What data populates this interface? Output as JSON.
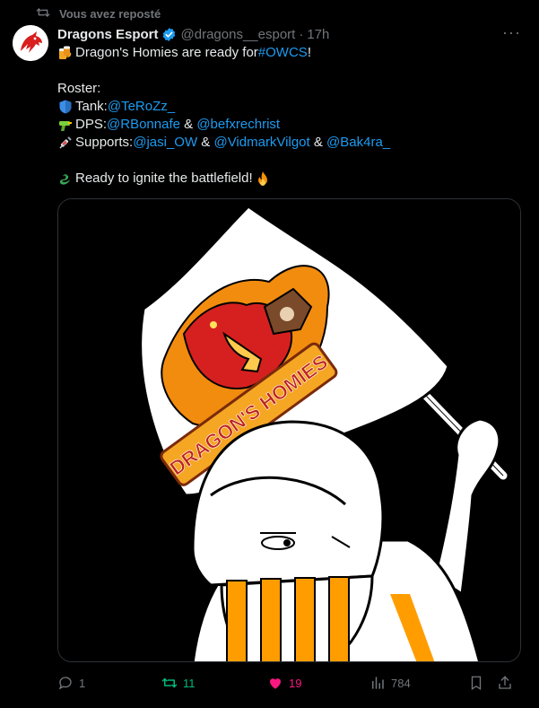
{
  "repost_notice": "Vous avez reposté",
  "tweet": {
    "author_name": "Dragons Esport",
    "handle": "@dragons__esport",
    "separator": "·",
    "time": "17h",
    "line1_text": "Dragon's Homies are ready for ",
    "line1_hashtag": "#OWCS",
    "line1_end": "!",
    "roster_label": "Roster:",
    "tank_label": "Tank: ",
    "tank_player": "@TeRoZz_",
    "dps_label": "DPS: ",
    "dps_player1": "@RBonnafe",
    "amp": " & ",
    "dps_player2": "@befxrechrist",
    "supports_label": "Supports: ",
    "support_player1": "@jasi_OW",
    "support_player2": "@VidmarkVilgot",
    "support_player3": "@Bak4ra_",
    "closing": "Ready to ignite the battlefield!",
    "image_flag_text": "DRAGON'S HOMIES"
  },
  "actions": {
    "replies": "1",
    "reposts": "11",
    "likes": "19",
    "views": "784"
  },
  "colors": {
    "link": "#1d9bf0",
    "repost_active": "#00ba7c",
    "like_active": "#f91880",
    "muted": "#71767b",
    "orange": "#ff9d00"
  }
}
